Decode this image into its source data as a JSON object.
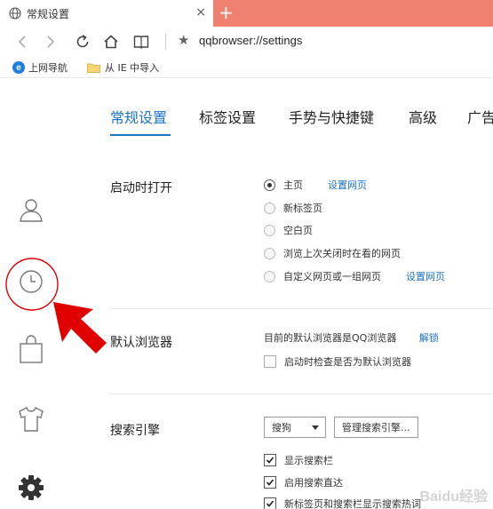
{
  "browser": {
    "tab_title": "常规设置",
    "tab_close": "×",
    "new_tab": "+",
    "url": "qqbrowser://settings"
  },
  "bookmarks": [
    {
      "label": "上网导航",
      "icon": "ie-icon"
    },
    {
      "label": "从 IE 中导入",
      "icon": "folder-icon"
    }
  ],
  "settings": {
    "tabs": [
      "常规设置",
      "标签设置",
      "手势与快捷键",
      "高级",
      "广告"
    ],
    "active_tab": 0,
    "startup": {
      "title": "启动时打开",
      "options": [
        {
          "label": "主页",
          "link": "设置网页",
          "checked": true
        },
        {
          "label": "新标签页",
          "checked": false
        },
        {
          "label": "空白页",
          "checked": false
        },
        {
          "label": "浏览上次关闭时在看的网页",
          "checked": false
        },
        {
          "label": "自定义网页或一组网页",
          "link": "设置网页",
          "checked": false
        }
      ]
    },
    "default_browser": {
      "title": "默认浏览器",
      "status": "目前的默认浏览器是QQ浏览器",
      "unbind": "解锁",
      "check_label": "启动时检查是否为默认浏览器"
    },
    "search": {
      "title": "搜索引擎",
      "engine": "搜狗",
      "manage": "管理搜索引擎...",
      "options": [
        {
          "label": "显示搜索栏",
          "checked": true
        },
        {
          "label": "启用搜索直达",
          "checked": true
        },
        {
          "label": "新标签页和搜索栏显示搜索热词",
          "checked": true
        }
      ]
    }
  },
  "watermark": "Baidu经验",
  "colors": {
    "tab_strip": "#f08070",
    "accent": "#1a73c8",
    "annotation": "#e00000"
  }
}
